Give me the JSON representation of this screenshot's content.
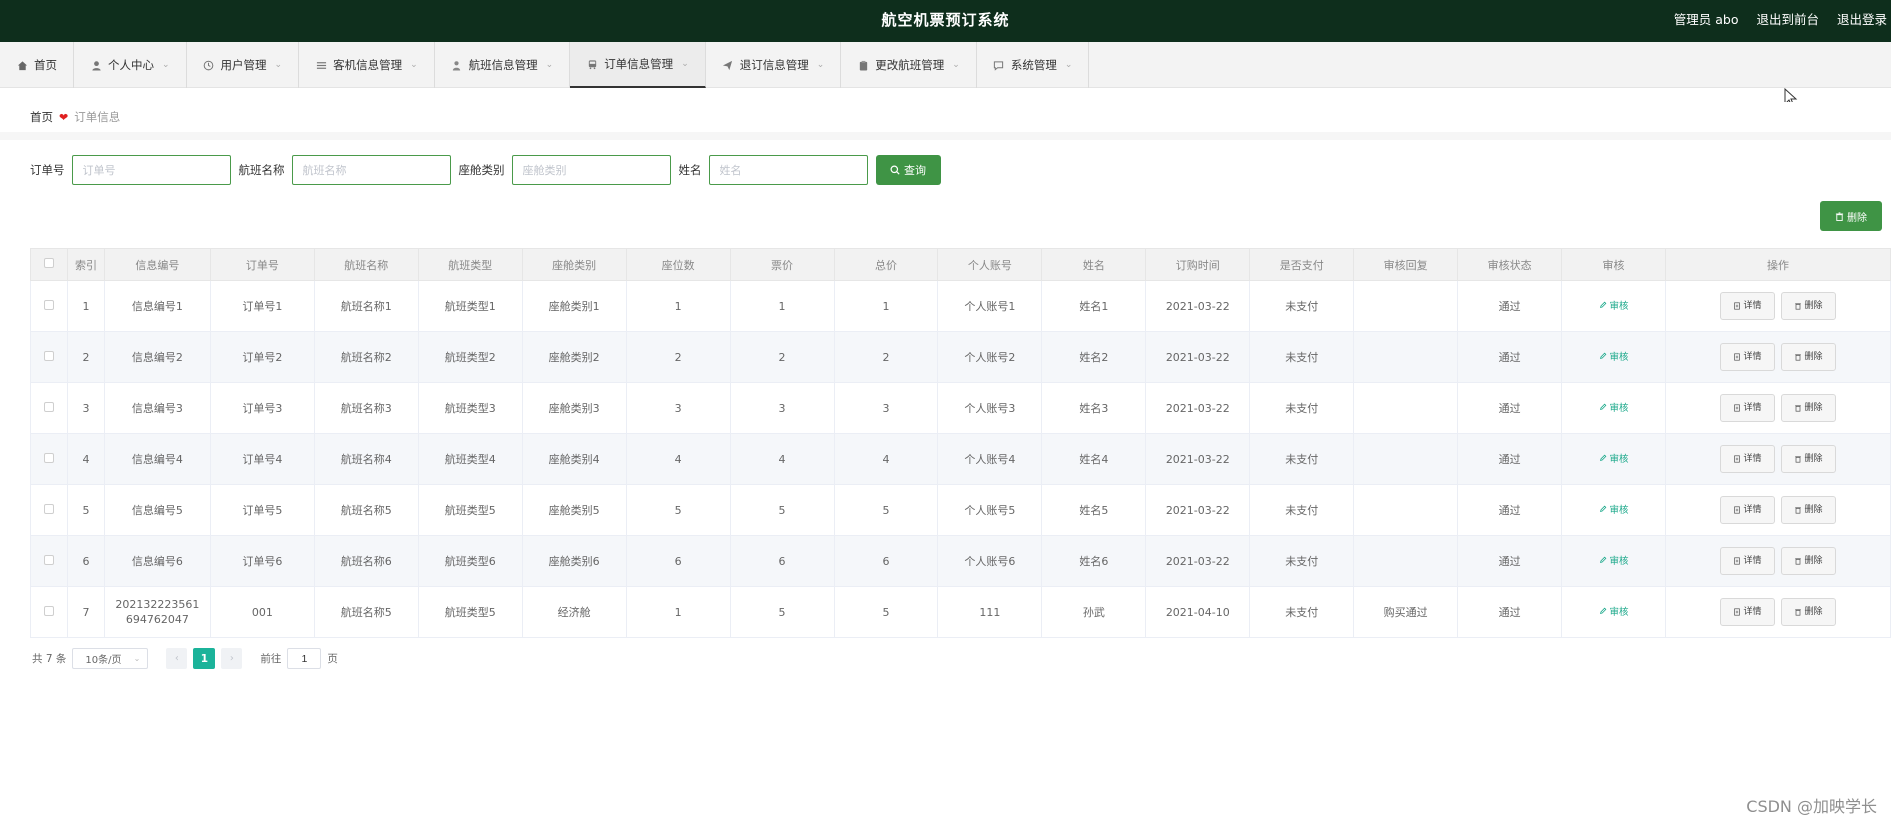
{
  "header": {
    "title": "航空机票预订系统",
    "admin_label": "管理员 abo",
    "to_front": "退出到前台",
    "logout": "退出登录"
  },
  "nav": [
    {
      "label": "首页",
      "icon": "home-icon",
      "chevron": false
    },
    {
      "label": "个人中心",
      "icon": "user-icon",
      "chevron": true
    },
    {
      "label": "用户管理",
      "icon": "clock-icon",
      "chevron": true
    },
    {
      "label": "客机信息管理",
      "icon": "list-icon",
      "chevron": true
    },
    {
      "label": "航班信息管理",
      "icon": "person-icon",
      "chevron": true
    },
    {
      "label": "订单信息管理",
      "icon": "bus-icon",
      "chevron": true,
      "active": true
    },
    {
      "label": "退订信息管理",
      "icon": "send-icon",
      "chevron": true
    },
    {
      "label": "更改航班管理",
      "icon": "clipboard-icon",
      "chevron": true
    },
    {
      "label": "系统管理",
      "icon": "chat-icon",
      "chevron": true
    }
  ],
  "breadcrumb": {
    "home": "首页",
    "current": "订单信息"
  },
  "search": {
    "order_label": "订单号",
    "order_placeholder": "订单号",
    "flight_label": "航班名称",
    "flight_placeholder": "航班名称",
    "seat_label": "座舱类别",
    "seat_placeholder": "座舱类别",
    "name_label": "姓名",
    "name_placeholder": "姓名",
    "query_label": "查询"
  },
  "delete_label": "删除",
  "table": {
    "headers": [
      "",
      "索引",
      "信息编号",
      "订单号",
      "航班名称",
      "航班类型",
      "座舱类别",
      "座位数",
      "票价",
      "总价",
      "个人账号",
      "姓名",
      "订购时间",
      "是否支付",
      "审核回复",
      "审核状态",
      "审核",
      "操作"
    ],
    "rows": [
      [
        "1",
        "信息编号1",
        "订单号1",
        "航班名称1",
        "航班类型1",
        "座舱类别1",
        "1",
        "1",
        "1",
        "个人账号1",
        "姓名1",
        "2021-03-22",
        "未支付",
        "",
        "通过"
      ],
      [
        "2",
        "信息编号2",
        "订单号2",
        "航班名称2",
        "航班类型2",
        "座舱类别2",
        "2",
        "2",
        "2",
        "个人账号2",
        "姓名2",
        "2021-03-22",
        "未支付",
        "",
        "通过"
      ],
      [
        "3",
        "信息编号3",
        "订单号3",
        "航班名称3",
        "航班类型3",
        "座舱类别3",
        "3",
        "3",
        "3",
        "个人账号3",
        "姓名3",
        "2021-03-22",
        "未支付",
        "",
        "通过"
      ],
      [
        "4",
        "信息编号4",
        "订单号4",
        "航班名称4",
        "航班类型4",
        "座舱类别4",
        "4",
        "4",
        "4",
        "个人账号4",
        "姓名4",
        "2021-03-22",
        "未支付",
        "",
        "通过"
      ],
      [
        "5",
        "信息编号5",
        "订单号5",
        "航班名称5",
        "航班类型5",
        "座舱类别5",
        "5",
        "5",
        "5",
        "个人账号5",
        "姓名5",
        "2021-03-22",
        "未支付",
        "",
        "通过"
      ],
      [
        "6",
        "信息编号6",
        "订单号6",
        "航班名称6",
        "航班类型6",
        "座舱类别6",
        "6",
        "6",
        "6",
        "个人账号6",
        "姓名6",
        "2021-03-22",
        "未支付",
        "",
        "通过"
      ],
      [
        "7",
        "202132223561694762047",
        "001",
        "航班名称5",
        "航班类型5",
        "经济舱",
        "1",
        "5",
        "5",
        "111",
        "孙武",
        "2021-04-10",
        "未支付",
        "购买通过",
        "通过"
      ]
    ],
    "audit_link": "审核",
    "detail_btn": "详情",
    "delete_btn": "删除"
  },
  "pager": {
    "total": "共 7 条",
    "page_size": "10条/页",
    "current": "1",
    "goto_prefix": "前往",
    "goto_value": "1",
    "goto_suffix": "页"
  },
  "watermark": "CSDN @加映学长",
  "colors": {
    "header_bg": "#0e2e1c",
    "primary": "#3f9445",
    "pager_active": "#1bb39a"
  }
}
